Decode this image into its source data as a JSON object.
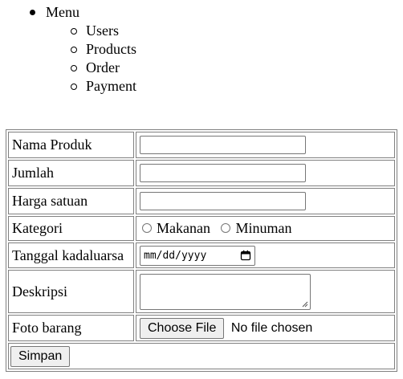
{
  "menu": {
    "title": "Menu",
    "items": [
      {
        "label": "Users"
      },
      {
        "label": "Products"
      },
      {
        "label": "Order"
      },
      {
        "label": "Payment"
      }
    ]
  },
  "form": {
    "nama_produk": {
      "label": "Nama Produk",
      "value": ""
    },
    "jumlah": {
      "label": "Jumlah",
      "value": ""
    },
    "harga_satuan": {
      "label": "Harga satuan",
      "value": ""
    },
    "kategori": {
      "label": "Kategori",
      "options": [
        {
          "label": "Makanan",
          "checked": false
        },
        {
          "label": "Minuman",
          "checked": false
        }
      ]
    },
    "tanggal": {
      "label": "Tanggal kadaluarsa",
      "placeholder": "mm/dd/yyyy"
    },
    "deskripsi": {
      "label": "Deskripsi",
      "value": ""
    },
    "foto": {
      "label": "Foto barang",
      "button_label": "Choose File",
      "status": "No file chosen"
    },
    "submit_label": "Simpan"
  }
}
